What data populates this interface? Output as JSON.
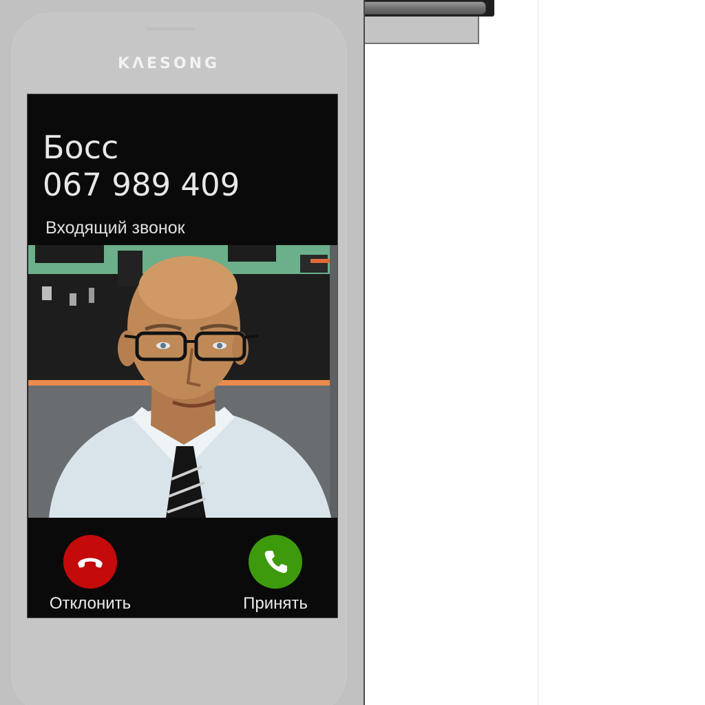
{
  "phone": {
    "brand": "KΛESONG"
  },
  "call": {
    "caller_name": "Босс",
    "caller_number": "067 989 409",
    "status": "Входящий звонок",
    "decline_label": "Отклонить",
    "accept_label": "Принять",
    "decline_icon": "phone-hangup-icon",
    "accept_icon": "phone-icon"
  },
  "colors": {
    "decline": "#c40a0a",
    "accept": "#3e9a0d",
    "screen_bg": "#0a0a0a",
    "phone_body": "#c1c1c1"
  }
}
